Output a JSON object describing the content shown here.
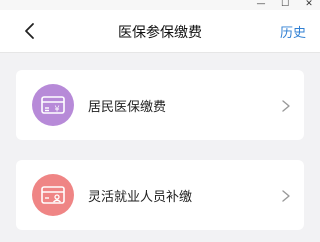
{
  "window_controls": {
    "minimize": "—",
    "maximize": "☐",
    "close": "✕"
  },
  "header": {
    "title": "医保参保缴费",
    "history_link": "历史",
    "back_icon": "chevron-left-icon"
  },
  "items": [
    {
      "label": "居民医保缴费",
      "icon": "card-yuan-icon",
      "icon_bg": "#b78ad8"
    },
    {
      "label": "灵活就业人员补缴",
      "icon": "card-person-icon",
      "icon_bg": "#ef8585"
    }
  ],
  "colors": {
    "accent": "#2f7fd3",
    "background": "#f2f2f4"
  }
}
